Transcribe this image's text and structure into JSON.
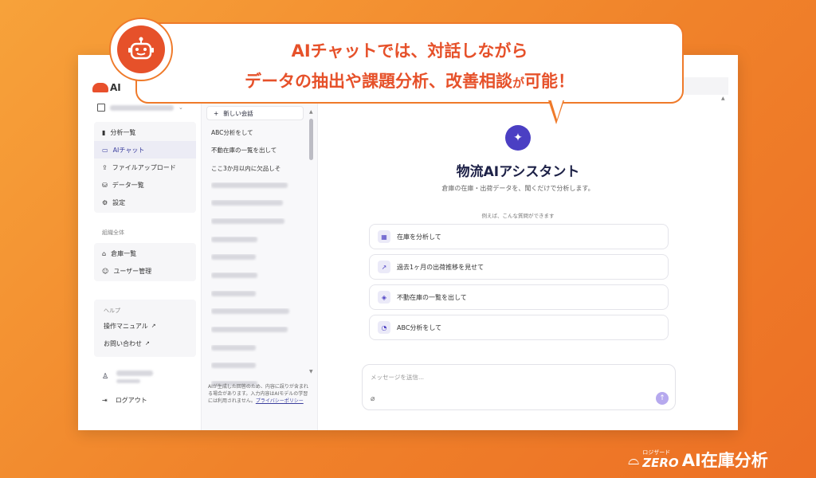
{
  "callout": {
    "line1": "AIチャットでは、対話しながら",
    "line2_main": "データの抽出や課題分析、改善相談",
    "line2_small": "が",
    "line2_end": "可能！"
  },
  "app": {
    "brand": "AI"
  },
  "sidebar": {
    "nav": [
      {
        "label": "分析一覧",
        "icon": "bar-chart-icon"
      },
      {
        "label": "AIチャット",
        "icon": "chat-icon",
        "active": true
      },
      {
        "label": "ファイルアップロード",
        "icon": "upload-icon"
      },
      {
        "label": "データ一覧",
        "icon": "database-icon"
      },
      {
        "label": "設定",
        "icon": "gear-icon"
      }
    ],
    "org_section_label": "組織全体",
    "org_nav": [
      {
        "label": "倉庫一覧",
        "icon": "warehouse-icon"
      },
      {
        "label": "ユーザー管理",
        "icon": "users-icon"
      }
    ],
    "help": {
      "label": "ヘルプ",
      "links": [
        "操作マニュアル",
        "お問い合わせ"
      ]
    },
    "logout": "ログアウト"
  },
  "conversations": {
    "new_label": "新しい会話",
    "items": [
      "ABC分析をして",
      "不動在庫の一覧を出して",
      "ここ3か月以内に欠品しそ"
    ]
  },
  "disclaimer": {
    "text": "AIが生成した回答のため、内容に誤りが含まれる場合があります。入力内容はAIモデルの学習には利用されません。",
    "link": "プライバシーポリシー"
  },
  "assistant": {
    "title": "物流AIアシスタント",
    "subtitle": "倉庫の在庫・出荷データを、聞くだけで分析します。",
    "example_label": "例えば、こんな質問ができます",
    "suggestions": [
      {
        "label": "在庫を分析して",
        "icon": "boxes-icon"
      },
      {
        "label": "過去1ヶ月の出荷推移を見せて",
        "icon": "trend-icon"
      },
      {
        "label": "不動在庫の一覧を出して",
        "icon": "package-icon"
      },
      {
        "label": "ABC分析をして",
        "icon": "pie-icon"
      }
    ]
  },
  "input": {
    "placeholder": "メッセージを送信..."
  },
  "footer": {
    "brand_small": "ロジザード",
    "brand_zero": "ZERO",
    "brand_big": "AI在庫分析"
  }
}
